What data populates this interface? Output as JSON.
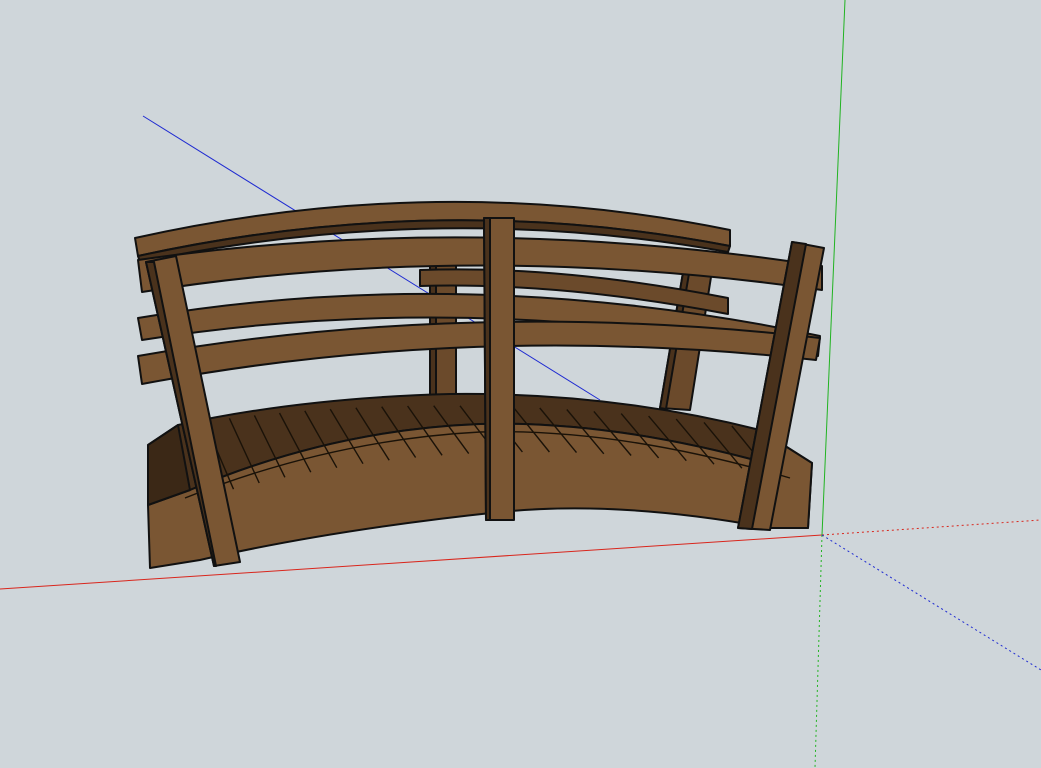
{
  "scene": {
    "background_color": "#cfd6da",
    "axes": {
      "x_axis_color": "#d9261c",
      "y_axis_color": "#21b321",
      "z_axis_color": "#1f2bd1"
    },
    "model": {
      "kind": "arched wooden bridge",
      "colors": {
        "wood_light": "#7a5633",
        "wood_mid": "#6b4a2b",
        "wood_dark": "#4a321c",
        "wood_shadow": "#3b2816",
        "edge": "#111111"
      }
    }
  }
}
